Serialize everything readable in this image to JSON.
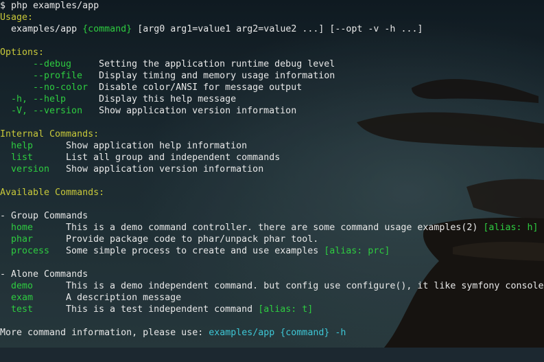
{
  "prompt": "$ php examples/app",
  "usage": {
    "heading": "Usage:",
    "script": "examples/app",
    "command": "{command}",
    "args": "[arg0 arg1=value1 arg2=value2 ...] [--opt -v -h ...]"
  },
  "options": {
    "heading": "Options:",
    "items": [
      {
        "flag": "--debug",
        "desc": "Setting the application runtime debug level"
      },
      {
        "flag": "--profile",
        "desc": "Display timing and memory usage information"
      },
      {
        "flag": "--no-color",
        "desc": "Disable color/ANSI for message output"
      },
      {
        "flag": "-h, --help",
        "desc": "Display this help message"
      },
      {
        "flag": "-V, --version",
        "desc": "Show application version information"
      }
    ]
  },
  "internal": {
    "heading": "Internal Commands:",
    "items": [
      {
        "name": "help",
        "desc": "Show application help information"
      },
      {
        "name": "list",
        "desc": "List all group and independent commands"
      },
      {
        "name": "version",
        "desc": "Show application version information"
      }
    ]
  },
  "available": {
    "heading": "Available Commands:",
    "group_heading": "- Group Commands",
    "group_items": [
      {
        "name": "home",
        "desc": "This is a demo command controller. there are some command usage examples(2)",
        "alias": "[alias: h]"
      },
      {
        "name": "phar",
        "desc": "Provide package code to phar/unpack phar tool.",
        "alias": ""
      },
      {
        "name": "process",
        "desc": "Some simple process to create and use examples",
        "alias": "[alias: prc]"
      }
    ],
    "alone_heading": "- Alone Commands",
    "alone_items": [
      {
        "name": "demo",
        "desc": "This is a demo independent command. but config use configure(), it like symfony console",
        "alias": ""
      },
      {
        "name": "exam",
        "desc": "A description message",
        "alias": ""
      },
      {
        "name": "test",
        "desc": "This is a test independent command",
        "alias": "[alias: t]"
      }
    ]
  },
  "footer": {
    "text": "More command information, please use:",
    "command": "examples/app {command} -h"
  },
  "colors": {
    "yellow": "#c8c83a",
    "green": "#2ecc40",
    "cyan": "#3ec7d6",
    "text": "#e6e6e6"
  }
}
